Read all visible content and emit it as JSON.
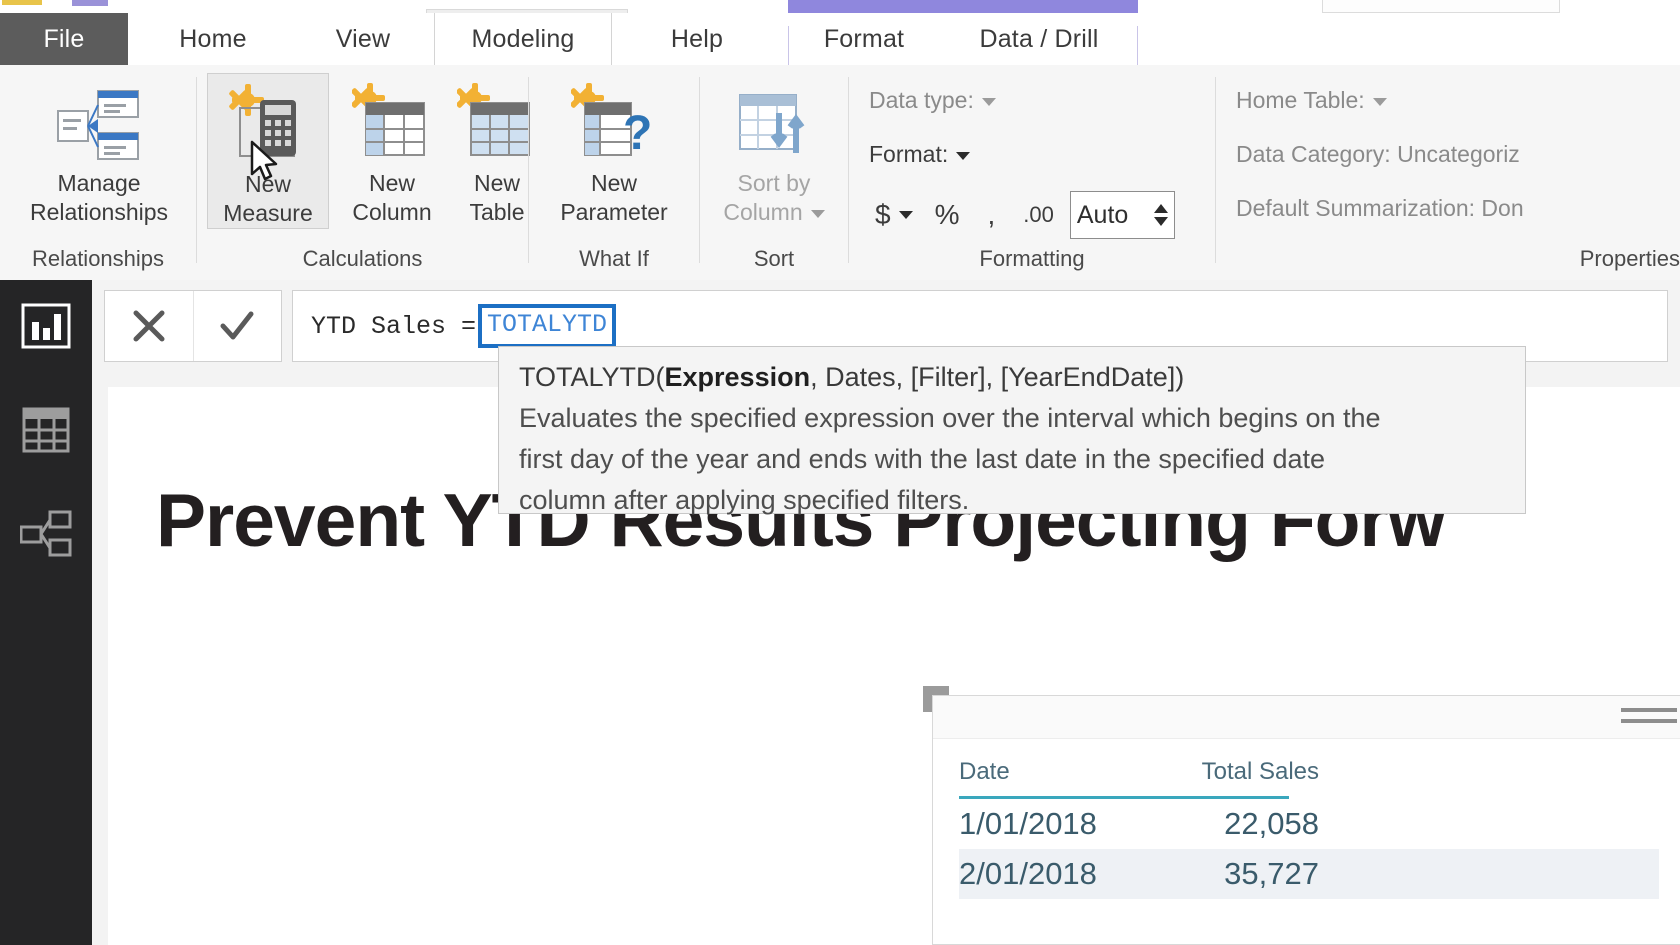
{
  "window": {
    "accent_purple": "#8f87dd",
    "accent_yellow": "#e8c44a"
  },
  "ribbon": {
    "tabs": [
      {
        "id": "file",
        "label": "File"
      },
      {
        "id": "home",
        "label": "Home"
      },
      {
        "id": "view",
        "label": "View"
      },
      {
        "id": "modeling",
        "label": "Modeling"
      },
      {
        "id": "help",
        "label": "Help"
      },
      {
        "id": "format",
        "label": "Format"
      },
      {
        "id": "data-drill",
        "label": "Data / Drill"
      }
    ],
    "active_tab": "Modeling",
    "groups": [
      {
        "name": "Relationships",
        "buttons": [
          {
            "label_line1": "Manage",
            "label_line2": "Relationships",
            "icon": "manage-relationships-icon"
          }
        ]
      },
      {
        "name": "Calculations",
        "buttons": [
          {
            "label_line1": "New",
            "label_line2": "Measure",
            "icon": "new-measure-icon"
          },
          {
            "label_line1": "New",
            "label_line2": "Column",
            "icon": "new-column-icon"
          },
          {
            "label_line1": "New",
            "label_line2": "Table",
            "icon": "new-table-icon"
          }
        ]
      },
      {
        "name": "What If",
        "buttons": [
          {
            "label_line1": "New",
            "label_line2": "Parameter",
            "icon": "new-parameter-icon"
          }
        ]
      },
      {
        "name": "Sort",
        "buttons": [
          {
            "label_line1": "Sort by",
            "label_line2": "Column",
            "icon": "sort-by-column-icon"
          }
        ]
      },
      {
        "name": "Formatting",
        "data_type_label": "Data type:",
        "format_label": "Format:",
        "currency_symbol": "$",
        "percent_symbol": "%",
        "thousands_symbol": ",",
        "decimal_symbol": ".00",
        "decimal_places_value": "Auto"
      },
      {
        "name": "Properties",
        "home_table_label": "Home Table:",
        "data_category_label": "Data Category: Uncategoriz",
        "default_summarization_label": "Default Summarization: Don"
      }
    ]
  },
  "rail": {
    "items": [
      {
        "id": "report-view",
        "icon": "bar-chart-icon",
        "selected": true
      },
      {
        "id": "data-view",
        "icon": "table-grid-icon",
        "selected": false
      },
      {
        "id": "model-view",
        "icon": "relationships-icon",
        "selected": false
      }
    ]
  },
  "formula_bar": {
    "cancel_icon": "close-icon",
    "commit_icon": "check-icon",
    "measure_prefix": "YTD Sales = ",
    "selected_token": "TOTALYTD"
  },
  "intellisense": {
    "signature_prefix": "TOTALYTD(",
    "signature_bold": "Expression",
    "signature_suffix": ", Dates, [Filter], [YearEndDate])",
    "description_line1": "Evaluates the specified expression over the interval which begins on the",
    "description_line2": "first day of the year and ends with the last date in the specified date",
    "description_line3": "column after applying specified filters."
  },
  "report": {
    "title": "Prevent YTD Results Projecting Forw",
    "visual": {
      "more_options_icon": "more-options-icon",
      "columns": [
        "Date",
        "Total Sales"
      ],
      "rows": [
        {
          "date": "1/01/2018",
          "total_sales": "22,058"
        },
        {
          "date": "2/01/2018",
          "total_sales": "35,727"
        }
      ],
      "header_rule_color": "#3aa7bd"
    }
  },
  "chart_data": {
    "type": "table",
    "title": "Prevent YTD Results Projecting Forw",
    "categories": [
      "1/01/2018",
      "2/01/2018"
    ],
    "series": [
      {
        "name": "Total Sales",
        "values": [
          22058,
          35727
        ]
      }
    ],
    "columns": [
      "Date",
      "Total Sales"
    ],
    "rows": [
      [
        "1/01/2018",
        "22,058"
      ],
      [
        "2/01/2018",
        "35,727"
      ]
    ]
  },
  "cursor": {
    "icon": "mouse-pointer-icon"
  }
}
